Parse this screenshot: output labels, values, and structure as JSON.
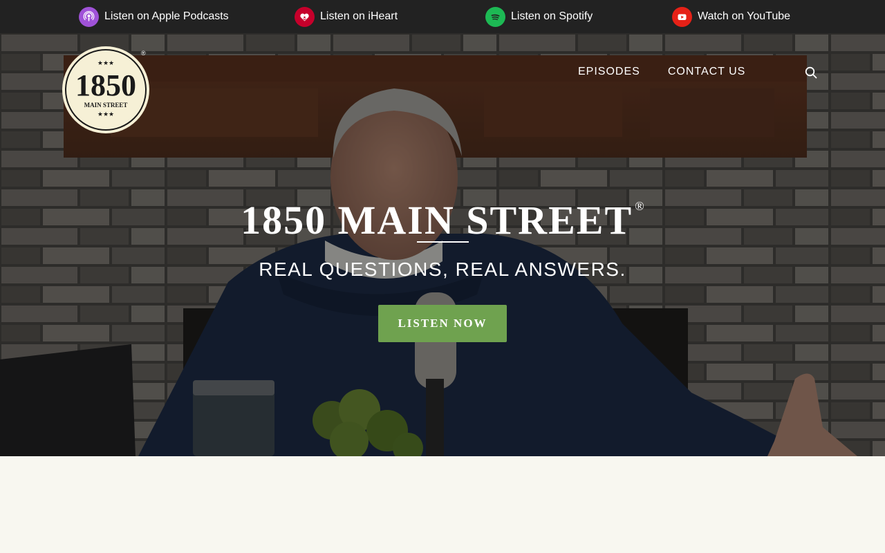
{
  "topbar": {
    "platforms": [
      {
        "label": "Listen on Apple Podcasts",
        "icon": "apple-podcasts-icon",
        "color": "#a052d8"
      },
      {
        "label": "Listen on iHeart",
        "icon": "iheart-icon",
        "color": "#c6002b"
      },
      {
        "label": "Listen on Spotify",
        "icon": "spotify-icon",
        "color": "#1db954"
      },
      {
        "label": "Watch on YouTube",
        "icon": "youtube-icon",
        "color": "#e62117"
      }
    ]
  },
  "logo": {
    "number": "1850",
    "street": "MAIN STREET",
    "stars": "★★★",
    "registered": "®"
  },
  "nav": {
    "items": [
      "EPISODES",
      "CONTACT US"
    ],
    "search_icon": "search-icon"
  },
  "hero": {
    "title": "1850 MAIN STREET",
    "registered": "®",
    "subtitle": "REAL QUESTIONS, REAL ANSWERS.",
    "cta_label": "LISTEN NOW"
  },
  "colors": {
    "topbar_bg": "#222222",
    "cta": "#6fa24f",
    "page_bg": "#f8f7f0",
    "logo_bg": "#f6f0d6"
  }
}
